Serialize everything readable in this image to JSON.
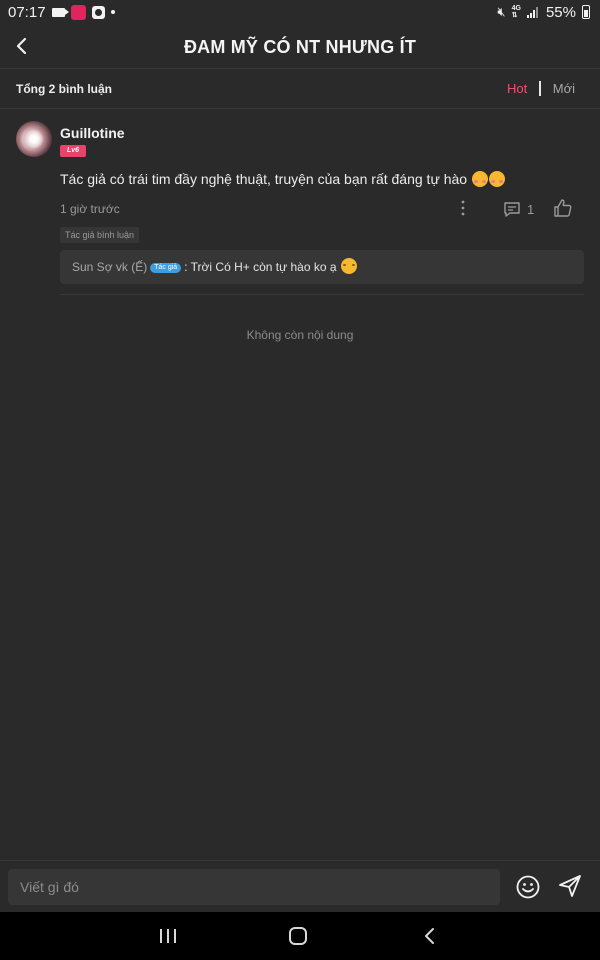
{
  "status_bar": {
    "time": "07:17",
    "battery": "55%",
    "app_icon_text": "MANGA TOON"
  },
  "header": {
    "title": "ĐAM MỸ CÓ NT NHƯNG ÍT"
  },
  "summary": {
    "total_label": "Tổng 2 bình luận",
    "sort_hot": "Hot",
    "sort_new": "Mới"
  },
  "comment": {
    "username": "Guillotine",
    "level": "Lv6",
    "text": "Tác giả có trái tim đầy nghệ thuật, truyện của bạn rất đáng tự hào",
    "time": "1 giờ trước",
    "reply_count": "1",
    "author_tag": "Tác giả bình luận",
    "reply": {
      "user": "Sun Sợ vk (Ế)",
      "badge": "Tác giả",
      "text": ": Trời Có H+ còn tự hào ko ạ"
    }
  },
  "end_text": "Không còn nội dung",
  "input": {
    "placeholder": "Viết gì đó"
  },
  "colors": {
    "background": "#2a2a2a",
    "accent_hot": "#f0506e",
    "level_badge": "#e8436a",
    "author_badge": "#3d9de0"
  }
}
